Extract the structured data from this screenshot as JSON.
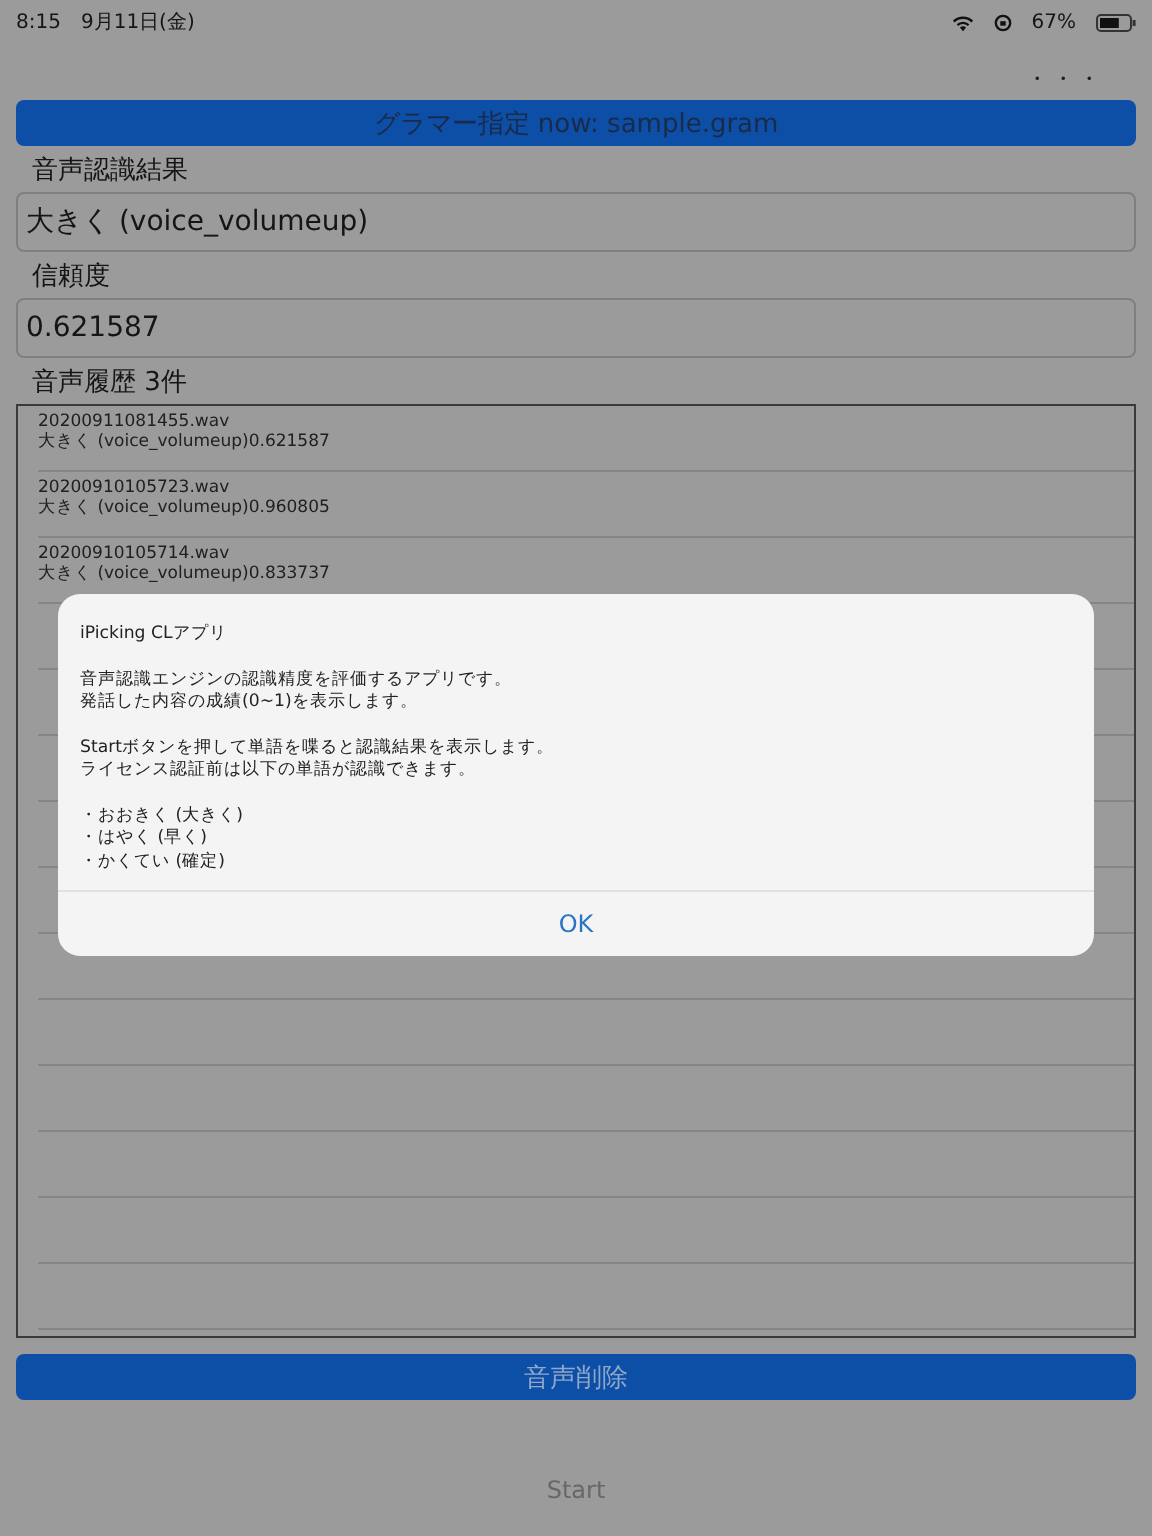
{
  "status_bar": {
    "time": "8:15",
    "date": "9月11日(金)",
    "battery_text": "67%"
  },
  "more_menu": "・・・",
  "grammar_button": "グラマー指定 now: sample.gram",
  "result": {
    "label": "音声認識結果",
    "value": "大きく (voice_volumeup)"
  },
  "confidence": {
    "label": "信頼度",
    "value": "0.621587"
  },
  "history": {
    "label": "音声履歴 3件",
    "rows": [
      {
        "file": "20200911081455.wav",
        "detail": "大きく (voice_volumeup)0.621587"
      },
      {
        "file": "20200910105723.wav",
        "detail": "大きく (voice_volumeup)0.960805"
      },
      {
        "file": "20200910105714.wav",
        "detail": "大きく (voice_volumeup)0.833737"
      }
    ]
  },
  "delete_button": "音声削除",
  "start_button": "Start",
  "alert": {
    "title": "iPicking CLアプリ",
    "paragraphs": [
      [
        "音声認識エンジンの認識精度を評価するアプリです。",
        "発話した内容の成績(0~1)を表示します。"
      ],
      [
        "Startボタンを押して単語を喋ると認識結果を表示します。",
        "ライセンス認証前は以下の単語が認識できます。"
      ]
    ],
    "items": [
      "・おおきく (大きく)",
      "・はやく (早く)",
      "・かくてい (確定)"
    ],
    "button": "OK"
  }
}
